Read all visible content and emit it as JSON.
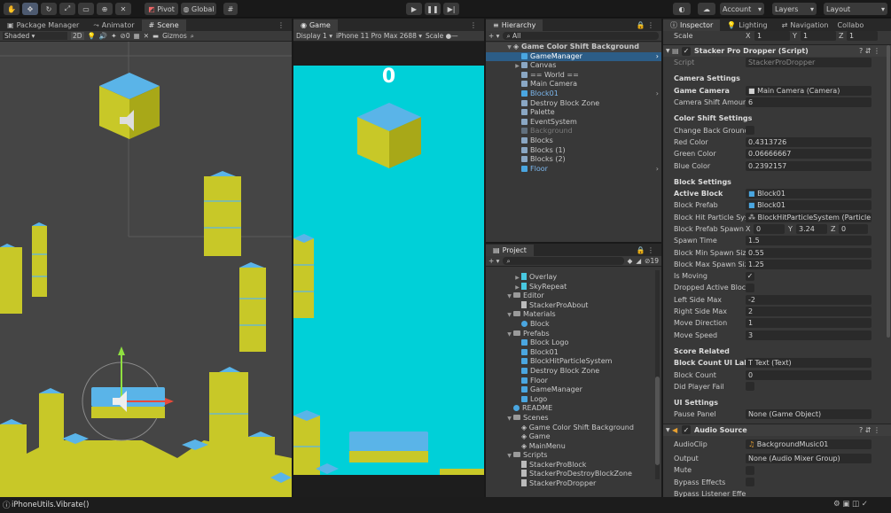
{
  "toolbar": {
    "pivot": "Pivot",
    "global": "Global",
    "account": "Account",
    "layers": "Layers",
    "layout": "Layout"
  },
  "scene_panel": {
    "tabs": [
      "Package Manager",
      "Animator",
      "Scene"
    ],
    "shading": "Shaded",
    "mode2d": "2D",
    "gizmos": "Gizmos",
    "hidden_count": "0"
  },
  "game_panel": {
    "tab": "Game",
    "display": "Display 1",
    "device": "iPhone 11 Pro Max",
    "res": "2688",
    "scale": "Scale",
    "score": "0"
  },
  "hierarchy": {
    "tab": "Hierarchy",
    "search": "All",
    "scene": "Game Color Shift Background",
    "items": [
      "GameManager",
      "Canvas",
      "== World ==",
      "Main Camera",
      "Block01",
      "Destroy Block Zone",
      "Palette",
      "EventSystem",
      "Background",
      "Blocks",
      "Blocks (1)",
      "Blocks (2)",
      "Floor"
    ]
  },
  "project": {
    "tab": "Project",
    "badge": "19",
    "items": [
      "Overlay",
      "SkyRepeat",
      "Editor",
      "StackerProAbout",
      "Materials",
      "Block",
      "Prefabs",
      "Block Logo",
      "Block01",
      "BlockHitParticleSystem",
      "Destroy Block Zone",
      "Floor",
      "GameManager",
      "Logo",
      "README",
      "Scenes",
      "Game Color Shift Background",
      "Game",
      "MainMenu",
      "Scripts",
      "StackerProBlock",
      "StackerProDestroyBlockZone",
      "StackerProDropper"
    ]
  },
  "inspector": {
    "tabs": [
      "Inspector",
      "Lighting",
      "Navigation",
      "Collabo"
    ],
    "scale_label": "Scale",
    "scale_x": "1",
    "scale_y": "1",
    "scale_z": "1",
    "component": "Stacker Pro Dropper (Script)",
    "script_label": "Script",
    "script_value": "StackerProDropper",
    "camera_header": "Camera Settings",
    "game_camera_label": "Game Camera",
    "game_camera_value": "Main Camera (Camera)",
    "cam_shift_label": "Camera Shift Amount",
    "cam_shift_value": "6",
    "color_header": "Color Shift Settings",
    "change_bg_label": "Change Back Ground",
    "red_label": "Red Color",
    "red_value": "0.4313726",
    "green_label": "Green Color",
    "green_value": "0.06666667",
    "blue_label": "Blue Color",
    "blue_value": "0.2392157",
    "block_header": "Block Settings",
    "active_block_label": "Active Block",
    "active_block_value": "Block01",
    "block_prefab_label": "Block Prefab",
    "block_prefab_value": "Block01",
    "particle_label": "Block Hit Particle Syste",
    "particle_value": "BlockHitParticleSystem (Particle",
    "spawn_loc_label": "Block Prefab Spawn Lo",
    "spawn_x": "0",
    "spawn_y": "3.24",
    "spawn_z": "0",
    "spawn_time_label": "Spawn Time",
    "spawn_time_value": "1.5",
    "min_size_label": "Block Min Spawn Size",
    "min_size_value": "0.55",
    "max_size_label": "Block Max Spawn Size",
    "max_size_value": "1.25",
    "is_moving_label": "Is Moving",
    "dropped_label": "Dropped Active Block",
    "left_max_label": "Left Side Max",
    "left_max_value": "-2",
    "right_max_label": "Right Side Max",
    "right_max_value": "2",
    "move_dir_label": "Move Direction",
    "move_dir_value": "1",
    "move_speed_label": "Move Speed",
    "move_speed_value": "3",
    "score_header": "Score Related",
    "count_ui_label": "Block Count UI Label",
    "count_ui_value": "Text (Text)",
    "block_count_label": "Block Count",
    "block_count_value": "0",
    "fail_label": "Did Player Fail",
    "ui_header": "UI Settings",
    "pause_label": "Pause Panel",
    "pause_value": "None (Game Object)",
    "audio_component": "Audio Source",
    "clip_label": "AudioClip",
    "clip_value": "BackgroundMusic01",
    "output_label": "Output",
    "output_value": "None (Audio Mixer Group)",
    "mute_label": "Mute",
    "bypass_label": "Bypass Effects",
    "bypass_listener_label": "Bypass Listener Effects"
  },
  "status": {
    "message": "iPhoneUtils.Vibrate()"
  },
  "colors": {
    "game_bg": "#00d0d8",
    "block_top": "#5ab4e8",
    "block_side": "#d2d228",
    "selection": "#2c5d87"
  }
}
